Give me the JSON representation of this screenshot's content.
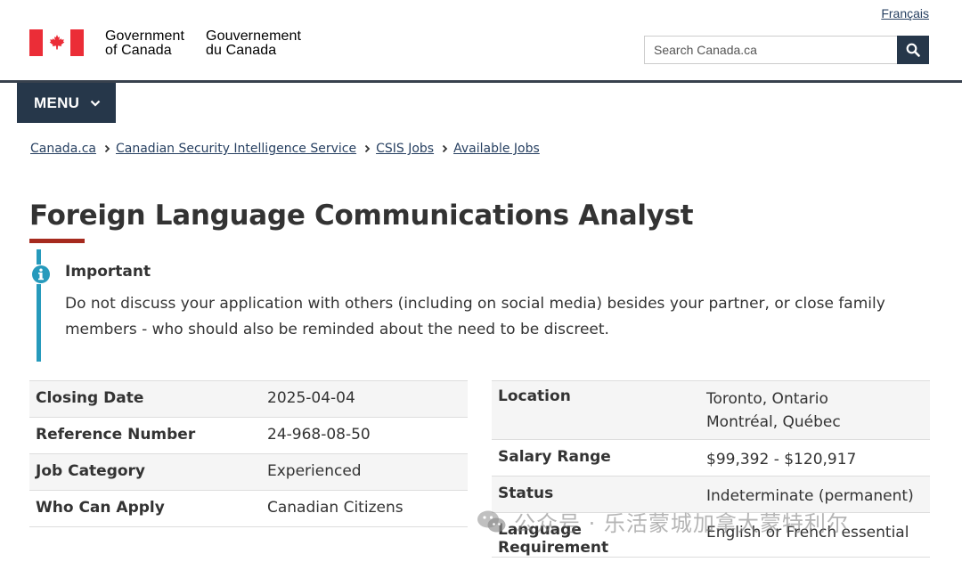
{
  "header": {
    "language_link": "Français",
    "signature_en": [
      "Government",
      "of Canada"
    ],
    "signature_fr": [
      "Gouvernement",
      "du Canada"
    ],
    "search_placeholder": "Search Canada.ca",
    "menu_label": "MENU"
  },
  "breadcrumb": [
    "Canada.ca",
    "Canadian Security Intelligence Service",
    "CSIS Jobs",
    "Available Jobs"
  ],
  "page_title": "Foreign Language Communications Analyst",
  "alert": {
    "title": "Important",
    "body": "Do not discuss your application with others (including on social media) besides your partner, or close family members - who should also be reminded about the need to be discreet."
  },
  "job_details_left": [
    {
      "key": "Closing Date",
      "value": "2025-04-04"
    },
    {
      "key": "Reference Number",
      "value": "24-968-08-50"
    },
    {
      "key": "Job Category",
      "value": "Experienced"
    },
    {
      "key": "Who Can Apply",
      "value": "Canadian Citizens"
    }
  ],
  "job_details_right": [
    {
      "key": "Location",
      "values": [
        "Toronto, Ontario",
        "Montréal, Québec"
      ]
    },
    {
      "key": "Salary Range",
      "values": [
        "$99,392 - $120,917"
      ]
    },
    {
      "key": "Status",
      "values": [
        "Indeterminate (permanent)"
      ]
    },
    {
      "key": "Language Requirement",
      "values": [
        "English or French essential"
      ]
    }
  ],
  "watermark": "公众号 · 乐活蒙城加拿大蒙特利尔",
  "colors": {
    "header_dark": "#26374a",
    "flag_red": "#eb2d37",
    "title_underline": "#a62a1e",
    "alert_accent": "#269abc",
    "link": "#284162"
  },
  "icons": {
    "search": "search-icon",
    "menu_chevron": "chevron-down-icon",
    "breadcrumb_separator": "chevron-right-icon",
    "alert": "info-icon",
    "flag": "maple-leaf-icon"
  }
}
